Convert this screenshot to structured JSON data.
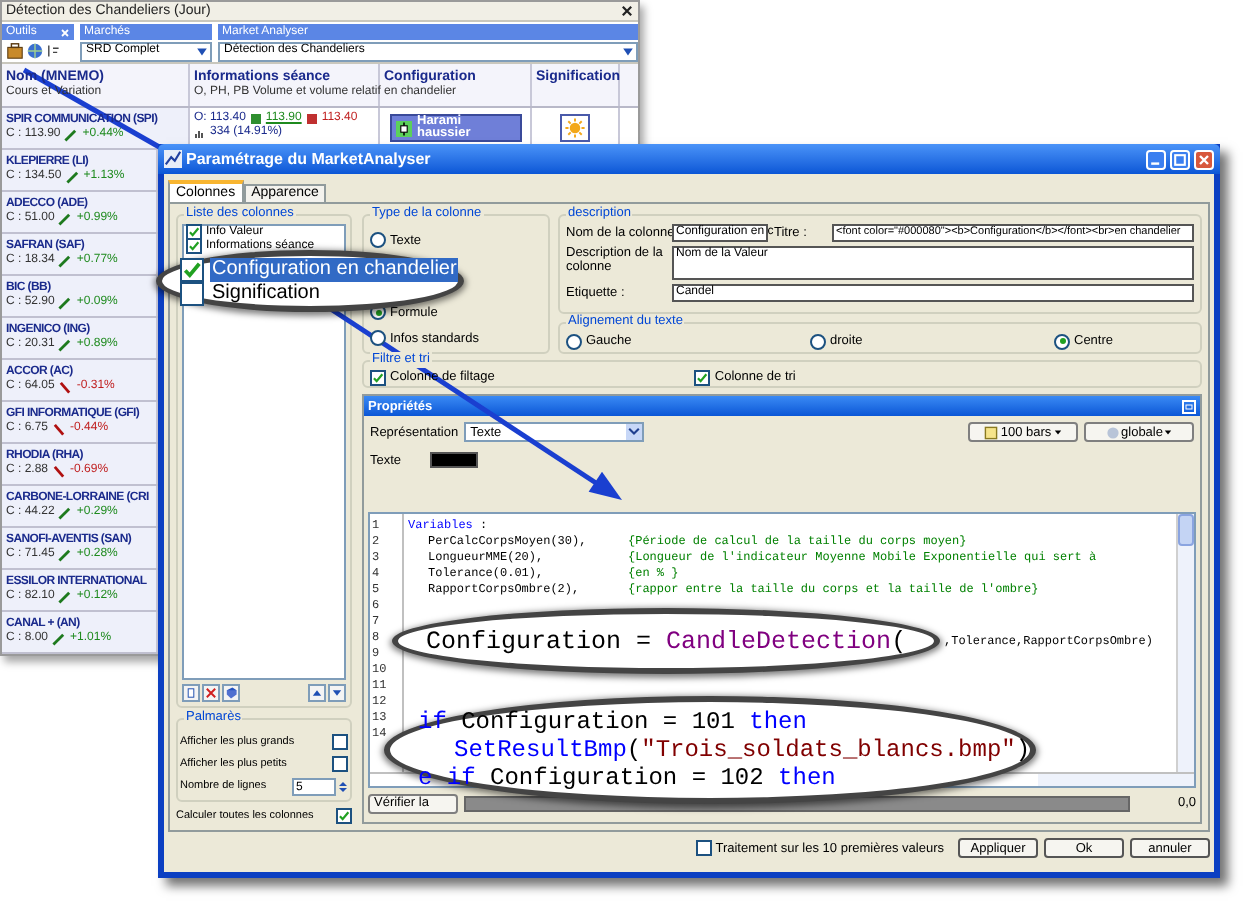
{
  "main_window": {
    "title": "Détection des Chandeliers (Jour)",
    "panels": [
      {
        "label": "Outils"
      },
      {
        "label": "Marchés",
        "value": "SRD Complet"
      },
      {
        "label": "Market Analyser",
        "value": "Détection des Chandeliers"
      }
    ],
    "columns": [
      {
        "title": "Nom (MNEMO)",
        "subtitle": "Cours et Variation"
      },
      {
        "title": "Informations séance",
        "subtitle": "O, PH, PB Volume et volume relatif"
      },
      {
        "title": "Configuration",
        "subtitle": "en chandelier"
      },
      {
        "title": "Signification"
      }
    ],
    "first_row": {
      "open": "O: 113.40",
      "high": "113.90",
      "low": "113.40",
      "volume": "334 (14.91%)",
      "configuration": "Harami haussier"
    },
    "stocks": [
      {
        "name": "SPIR COMMUNICATION (SPI)",
        "price": "C : 113.90",
        "change": "+0.44%",
        "rising": true
      },
      {
        "name": "KLEPIERRE (LI)",
        "price": "C : 134.50",
        "change": "+1.13%",
        "rising": true
      },
      {
        "name": "ADECCO (ADE)",
        "price": "C : 51.00",
        "change": "+0.99%",
        "rising": true
      },
      {
        "name": "SAFRAN (SAF)",
        "price": "C : 18.34",
        "change": "+0.77%",
        "rising": true
      },
      {
        "name": "BIC (BB)",
        "price": "C : 52.90",
        "change": "+0.09%",
        "rising": true
      },
      {
        "name": "INGENICO (ING)",
        "price": "C : 20.31",
        "change": "+0.89%",
        "rising": true
      },
      {
        "name": "ACCOR (AC)",
        "price": "C : 64.05",
        "change": "-0.31%",
        "rising": false
      },
      {
        "name": "GFI INFORMATIQUE (GFI)",
        "price": "C : 6.75",
        "change": "-0.44%",
        "rising": false
      },
      {
        "name": "RHODIA (RHA)",
        "price": "C : 2.88",
        "change": "-0.69%",
        "rising": false
      },
      {
        "name": "CARBONE-LORRAINE (CRI",
        "price": "C : 44.22",
        "change": "+0.29%",
        "rising": true
      },
      {
        "name": "SANOFI-AVENTIS (SAN)",
        "price": "C : 71.45",
        "change": "+0.28%",
        "rising": true
      },
      {
        "name": "ESSILOR INTERNATIONAL",
        "price": "C : 82.10",
        "change": "+0.12%",
        "rising": true
      },
      {
        "name": "CANAL + (AN)",
        "price": "C : 8.00",
        "change": "+1.01%",
        "rising": true
      }
    ]
  },
  "dialog": {
    "title": "Paramétrage du MarketAnalyser",
    "tabs": [
      {
        "label": "Colonnes",
        "selected": true
      },
      {
        "label": "Apparence",
        "selected": false
      }
    ],
    "column_list": {
      "title": "Liste des colonnes",
      "items": [
        {
          "label": "Info Valeur",
          "checked": true,
          "selected": false,
          "magnified": false
        },
        {
          "label": "Informations séance",
          "checked": true,
          "selected": false,
          "magnified": false
        },
        {
          "label": "Configuration en chandelier",
          "checked": true,
          "selected": true,
          "magnified": true
        },
        {
          "label": "Signification",
          "checked": false,
          "selected": false,
          "magnified": true
        }
      ]
    },
    "ranking": {
      "title": "Palmarès",
      "options": [
        {
          "label": "Afficher les plus grands",
          "checked": false
        },
        {
          "label": "Afficher les plus petits",
          "checked": false
        }
      ],
      "lines_label": "Nombre de lignes",
      "lines_value": "5"
    },
    "compute_all": {
      "label": "Calculer toutes les colonnes",
      "checked": true
    },
    "column_type": {
      "title": "Type de la colonne",
      "options": [
        {
          "label": "Texte",
          "selected": false
        },
        {
          "label": "Formule",
          "selected": true
        },
        {
          "label": "Infos standards",
          "selected": false
        }
      ]
    },
    "description": {
      "title": "description",
      "name_label": "Nom de la colonne",
      "name_value": "Configuration en c",
      "title_label": "Titre :",
      "title_value": "<font color=\"#000080\"><b>Configuration</b></font><br>en chandelier",
      "description_label": "Description de la colonne",
      "description_value": "Nom de la Valeur",
      "tag_label": "Etiquette :",
      "tag_value": "Candel"
    },
    "alignment": {
      "title": "Alignement du texte",
      "options": [
        {
          "label": "Gauche",
          "selected": false
        },
        {
          "label": "droite",
          "selected": false
        },
        {
          "label": "Centre",
          "selected": true
        }
      ]
    },
    "filter": {
      "title": "Filtre et tri",
      "options": [
        {
          "label": "Colonne de filtage",
          "checked": true
        },
        {
          "label": "Colonne de tri",
          "checked": true
        }
      ]
    },
    "properties": {
      "title": "Propriétés",
      "representation_label": "Représentation",
      "representation_value": "Texte",
      "bars_button": "100 bars",
      "scope_button": "globale",
      "text_label": "Texte",
      "line_numbers": [
        "1",
        "2",
        "3",
        "4",
        "5",
        "6",
        "7",
        "8",
        "9",
        "10",
        "11",
        "12",
        "13",
        "14"
      ],
      "lines": [
        {
          "code": [
            {
              "kind": "keyword",
              "text": "Variables"
            },
            {
              "kind": "plain",
              "text": " :"
            }
          ]
        },
        {
          "code": [
            {
              "kind": "plain",
              "text": "PerCalcCorpsMoyen(30),"
            }
          ],
          "comment": "{Période de calcul de la taille du corps moyen}"
        },
        {
          "code": [
            {
              "kind": "plain",
              "text": "LongueurMME(20),"
            }
          ],
          "comment": "{Longueur de l'indicateur Moyenne Mobile Exponentielle qui sert à"
        },
        {
          "code": [
            {
              "kind": "plain",
              "text": "Tolerance(0.01),"
            }
          ],
          "comment": "{en % }"
        },
        {
          "code": [
            {
              "kind": "plain",
              "text": "RapportCorpsOmbre(2),"
            }
          ],
          "comment": "{rappor entre la taille du corps et la taille de l'ombre}"
        }
      ],
      "magnified_call": [
        {
          "kind": "plain",
          "text": "Configuration = "
        },
        {
          "kind": "function",
          "text": "CandleDetection"
        },
        {
          "kind": "plain",
          "text": "("
        }
      ],
      "call_tail": ",Tolerance,RapportCorpsOmbre)",
      "magnified_block": [
        {
          "indent": false,
          "code": [
            {
              "kind": "keyword",
              "text": "if"
            },
            {
              "kind": "plain",
              "text": " Configuration = 101 "
            },
            {
              "kind": "keyword",
              "text": "then"
            }
          ]
        },
        {
          "indent": true,
          "code": [
            {
              "kind": "keyword",
              "text": "SetResultBmp"
            },
            {
              "kind": "plain",
              "text": "("
            },
            {
              "kind": "string",
              "text": "\"Trois_soldats_blancs.bmp\""
            },
            {
              "kind": "plain",
              "text": ")"
            }
          ]
        },
        {
          "indent": false,
          "code": [
            {
              "kind": "keyword",
              "text": "e if"
            },
            {
              "kind": "plain",
              "text": " Configuration = 102 "
            },
            {
              "kind": "keyword",
              "text": "then"
            }
          ]
        }
      ],
      "check_button": "Vérifier la",
      "progress_reading": "0,0"
    },
    "footer": {
      "first_ten": {
        "label": "Traitement sur les 10 premières valeurs",
        "checked": false
      },
      "buttons": [
        "Appliquer",
        "Ok",
        "annuler"
      ]
    }
  }
}
